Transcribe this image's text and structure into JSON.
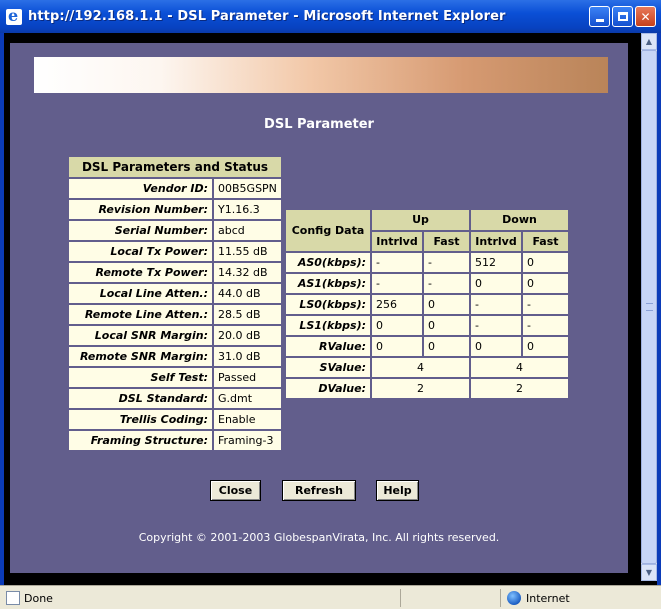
{
  "window": {
    "title": "http://192.168.1.1 - DSL Parameter - Microsoft Internet Explorer"
  },
  "page": {
    "title": "DSL Parameter",
    "copyright": "Copyright © 2001-2003 GlobespanVirata, Inc. All rights reserved."
  },
  "status_table": {
    "header": "DSL Parameters and Status",
    "rows": [
      {
        "label": "Vendor ID:",
        "value": "00B5GSPN"
      },
      {
        "label": "Revision Number:",
        "value": "Y1.16.3"
      },
      {
        "label": "Serial Number:",
        "value": "abcd"
      },
      {
        "label": "Local Tx Power:",
        "value": "11.55 dB"
      },
      {
        "label": "Remote Tx Power:",
        "value": "14.32 dB"
      },
      {
        "label": "Local Line Atten.:",
        "value": "44.0 dB"
      },
      {
        "label": "Remote Line Atten.:",
        "value": "28.5 dB"
      },
      {
        "label": "Local SNR Margin:",
        "value": "20.0 dB"
      },
      {
        "label": "Remote SNR Margin:",
        "value": "31.0 dB"
      },
      {
        "label": "Self Test:",
        "value": "Passed"
      },
      {
        "label": "DSL Standard:",
        "value": "G.dmt"
      },
      {
        "label": "Trellis Coding:",
        "value": "Enable"
      },
      {
        "label": "Framing Structure:",
        "value": "Framing-3"
      }
    ]
  },
  "config_table": {
    "corner": "Config Data",
    "up": "Up",
    "down": "Down",
    "intrlvd": "Intrlvd",
    "fast": "Fast",
    "rows": [
      {
        "label": "AS0(kbps):",
        "cells": [
          "-",
          "-",
          "512",
          "0"
        ]
      },
      {
        "label": "AS1(kbps):",
        "cells": [
          "-",
          "-",
          "0",
          "0"
        ]
      },
      {
        "label": "LS0(kbps):",
        "cells": [
          "256",
          "0",
          "-",
          "-"
        ]
      },
      {
        "label": "LS1(kbps):",
        "cells": [
          "0",
          "0",
          "-",
          "-"
        ]
      },
      {
        "label": "RValue:",
        "cells": [
          "0",
          "0",
          "0",
          "0"
        ]
      }
    ],
    "svalue": {
      "label": "SValue:",
      "up": "4",
      "down": "4"
    },
    "dvalue": {
      "label": "DValue:",
      "up": "2",
      "down": "2"
    }
  },
  "buttons": {
    "close": "Close",
    "refresh": "Refresh",
    "help": "Help"
  },
  "statusbar": {
    "status": "Done",
    "zone": "Internet"
  }
}
